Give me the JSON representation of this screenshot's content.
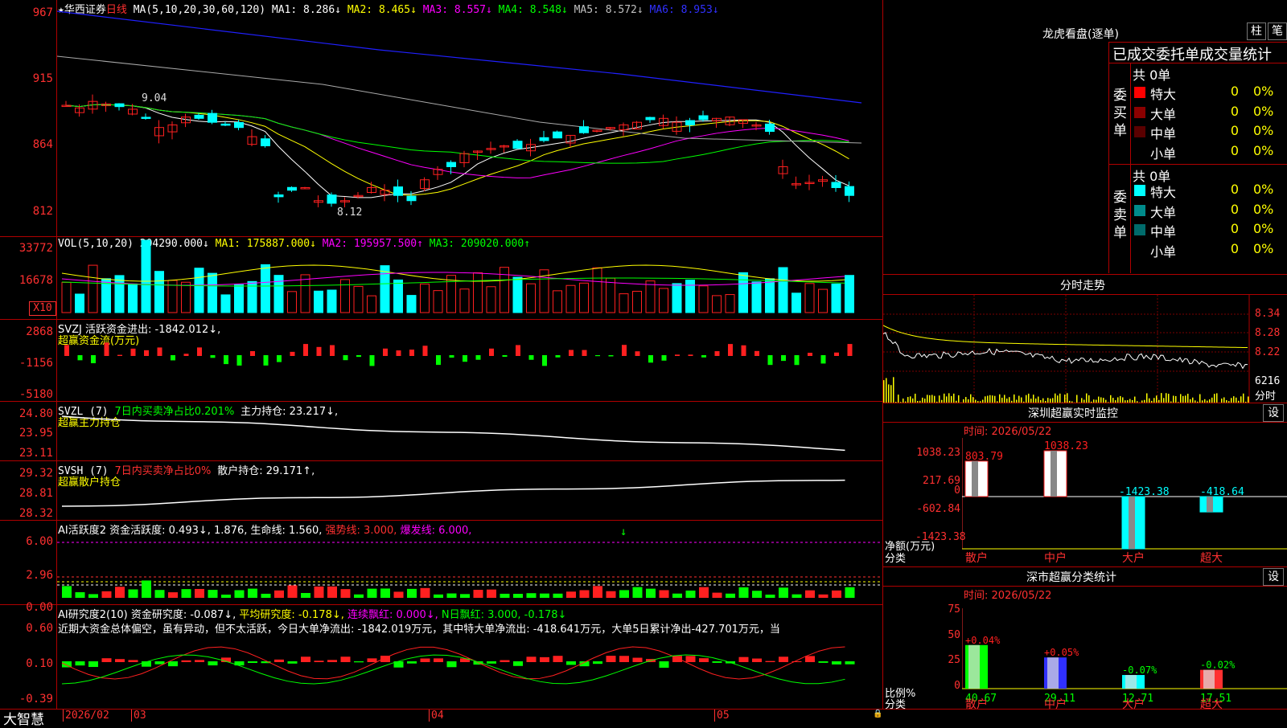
{
  "main": {
    "stock_name": "华西证券",
    "period": "日线",
    "star": "★",
    "ma_header": "MA(5,10,20,30,60,120)",
    "ma1": "MA1: 8.286↓",
    "ma2": "MA2: 8.465↓",
    "ma3": "MA3: 8.557↓",
    "ma4": "MA4: 8.548↓",
    "ma5": "MA5: 8.572↓",
    "ma6": "MA6: 8.953↓",
    "ticks": [
      "967",
      "915",
      "864",
      "812"
    ],
    "high_label": "9.04",
    "low_label": "8.12"
  },
  "vol": {
    "header": "VOL(5,10,20) 204290.000↓",
    "ma1": "MA1: 175887.000↓",
    "ma2": "MA2: 195957.500↑",
    "ma3": "MA3: 209020.000↑",
    "ticks": [
      "33772",
      "16678"
    ],
    "unit": "X10"
  },
  "svzj": {
    "header": "SVZJ  活跃资金进出: -1842.012↓,",
    "sub": "超赢资金流(万元)",
    "ticks": [
      "2868",
      "-1156",
      "-5180"
    ]
  },
  "svzl": {
    "header": "SVZL (7)",
    "net": "7日内买卖净占比0.201%",
    "hold": "主力持仓: 23.217↓,",
    "sub": "超赢主力持仓",
    "ticks": [
      "24.80",
      "23.95",
      "23.11"
    ]
  },
  "svsh": {
    "header": "SVSH (7)",
    "net": "7日内买卖净占比0%",
    "hold": "散户持仓: 29.171↑,",
    "sub": "超赢散户持仓",
    "ticks": [
      "29.32",
      "28.81",
      "28.32"
    ]
  },
  "ai2": {
    "header": "AI活跃度2",
    "act": "资金活跃度: 0.493↓, 1.876,",
    "life": "生命线: 1.560,",
    "strong": "强势线: 3.000,",
    "burst": "爆发线: 6.000,",
    "ticks": [
      "6.00",
      "2.96",
      "0.00"
    ]
  },
  "ai_research": {
    "header": "AI研究度2(10)",
    "r1": "资金研究度: -0.087↓,",
    "r2": "平均研究度: -0.178↓,",
    "r3": "连续飘红: 0.000↓,",
    "r4": "N日飘红: 3.000, -0.178↓",
    "desc": "近期大资金总体偏空，虽有异动，但不太活跃，今日大单净流出: -1842.019万元，其中特大单净流出: -418.641万元，大单5日累计净出-427.701万元，当",
    "ticks": [
      "0.60",
      "0.10",
      "-0.39"
    ]
  },
  "bottom": {
    "brand": "大智慧",
    "dates": [
      "2026/02",
      "03",
      "04",
      "05"
    ]
  },
  "panel": {
    "lhb_title": "龙虎看盘(逐单)",
    "btn_zhu": "柱",
    "btn_bi": "笔",
    "stat_title": "已成交委托单成交量统计",
    "buy_label": "委买单",
    "sell_label": "委卖单",
    "buy_total": "共 0单",
    "sell_total": "共 0单",
    "buy_rows": [
      {
        "name": "特大",
        "count": "0",
        "pct": "0%",
        "color": "#ff0000"
      },
      {
        "name": "大单",
        "count": "0",
        "pct": "0%",
        "color": "#8b0000"
      },
      {
        "name": "中单",
        "count": "0",
        "pct": "0%",
        "color": "#5a0000"
      },
      {
        "name": "小单",
        "count": "0",
        "pct": "0%",
        "color": "#000000"
      }
    ],
    "sell_rows": [
      {
        "name": "特大",
        "count": "0",
        "pct": "0%",
        "color": "#00ffff"
      },
      {
        "name": "大单",
        "count": "0",
        "pct": "0%",
        "color": "#008b8b"
      },
      {
        "name": "中单",
        "count": "0",
        "pct": "0%",
        "color": "#006b6b"
      },
      {
        "name": "小单",
        "count": "0",
        "pct": "0%",
        "color": "#000000"
      }
    ],
    "fenshi_title": "分时走势",
    "fenshi_ticks": [
      "8.34",
      "8.28",
      "8.22",
      "6216"
    ],
    "fenshi_unit": "分时",
    "sz_monitor_title": "深圳超赢实时监控",
    "set_btn": "设",
    "sz_date": "时间: 2026/05/22",
    "sz_ticks": [
      "1038.23",
      "217.69",
      "0",
      "-602.84",
      "-1423.38"
    ],
    "sz_ylabel": "净额(万元)",
    "sz_xlabel": "分类",
    "sz_values": [
      "803.79",
      "1038.23",
      "-1423.38",
      "-418.64"
    ],
    "categories": [
      "散户",
      "中户",
      "大户",
      "超大"
    ],
    "cls_title": "深市超赢分类统计",
    "cls_date": "时间: 2026/05/22",
    "cls_ticks": [
      "75",
      "50",
      "25",
      "0"
    ],
    "cls_ylabel": "比例%",
    "cls_xlabel": "分类",
    "cls_changes": [
      "+0.04%",
      "+0.05%",
      "-0.07%",
      "-0.02%"
    ],
    "cls_values": [
      "40.67",
      "29.11",
      "12.71",
      "17.51"
    ]
  },
  "colors": {
    "up": "#ff2020",
    "down": "#00ffff",
    "grid": "#b00000"
  }
}
